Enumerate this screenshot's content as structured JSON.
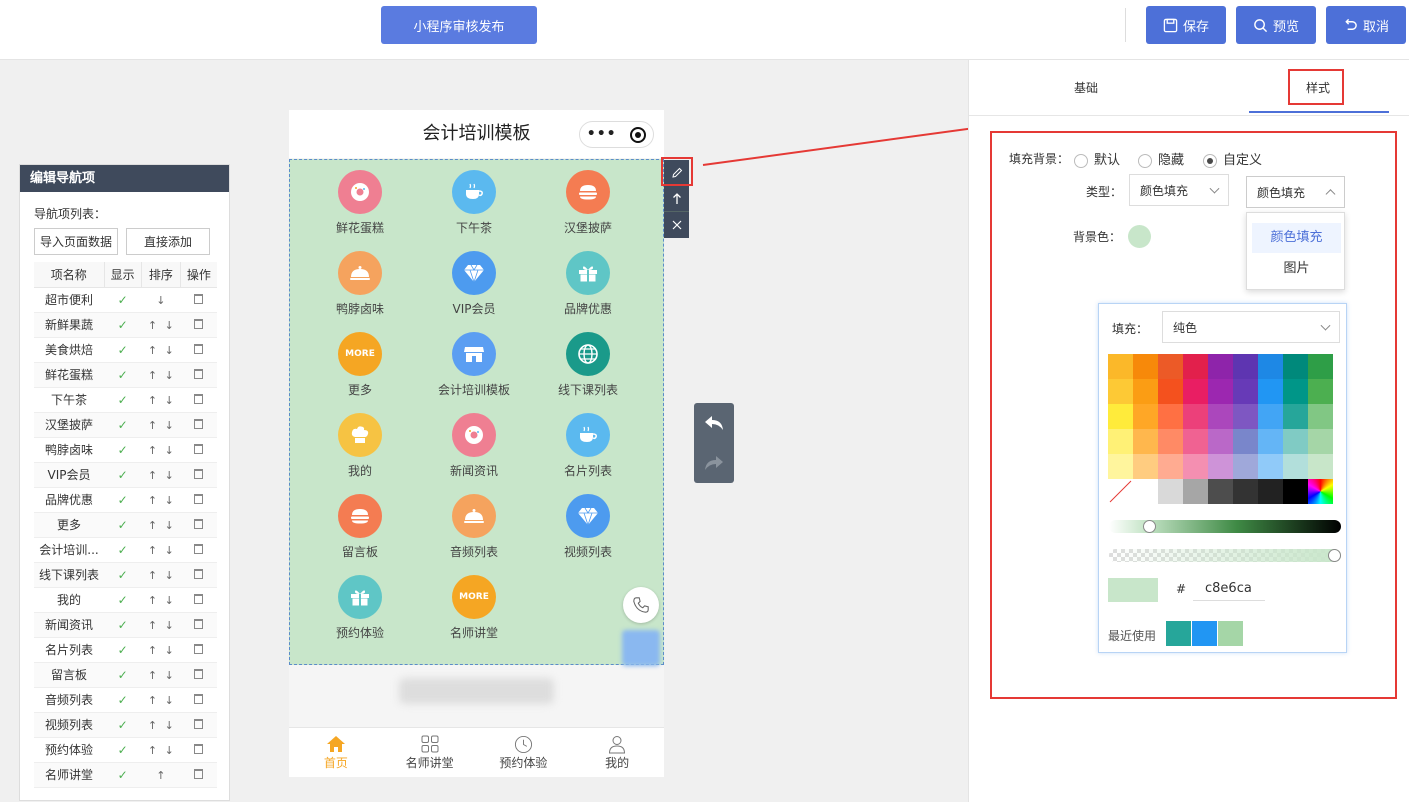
{
  "topbar": {
    "publish": "小程序审核发布",
    "save": "保存",
    "preview": "预览",
    "cancel": "取消"
  },
  "leftpanel": {
    "title": "编辑导航项",
    "list_label": "导航项列表：",
    "import_btn": "导入页面数据",
    "add_btn": "直接添加",
    "headers": [
      "项名称",
      "显示",
      "排序",
      "操作"
    ],
    "rows": [
      "超市便利",
      "新鲜果蔬",
      "美食烘焙",
      "鲜花蛋糕",
      "下午茶",
      "汉堡披萨",
      "鸭脖卤味",
      "VIP会员",
      "品牌优惠",
      "更多",
      "会计培训...",
      "线下课列表",
      "我的",
      "新闻资讯",
      "名片列表",
      "留言板",
      "音频列表",
      "视频列表",
      "预约体验",
      "名师讲堂"
    ],
    "check": "✓"
  },
  "phone": {
    "title": "会计培训模板",
    "items": [
      {
        "label": "鲜花蛋糕",
        "color": "#ef7f92",
        "icon": "donut"
      },
      {
        "label": "下午茶",
        "color": "#5bb9ef",
        "icon": "cup"
      },
      {
        "label": "汉堡披萨",
        "color": "#f47c52",
        "icon": "burger"
      },
      {
        "label": "鸭脖卤味",
        "color": "#f5a35e",
        "icon": "dish"
      },
      {
        "label": "VIP会员",
        "color": "#4d9bef",
        "icon": "diamond"
      },
      {
        "label": "品牌优惠",
        "color": "#5fc6c6",
        "icon": "gift"
      },
      {
        "label": "更多",
        "color": "#f5a623",
        "icon": "MORE"
      },
      {
        "label": "会计培训模板",
        "color": "#5b9ef2",
        "icon": "shop"
      },
      {
        "label": "线下课列表",
        "color": "#1a9a8a",
        "icon": "globe"
      },
      {
        "label": "我的",
        "color": "#f6c343",
        "icon": "chef"
      },
      {
        "label": "新闻资讯",
        "color": "#ef7f92",
        "icon": "donut"
      },
      {
        "label": "名片列表",
        "color": "#5bb9ef",
        "icon": "cup"
      },
      {
        "label": "留言板",
        "color": "#f47c52",
        "icon": "burger"
      },
      {
        "label": "音频列表",
        "color": "#f5a35e",
        "icon": "dish"
      },
      {
        "label": "视频列表",
        "color": "#4d9bef",
        "icon": "diamond"
      },
      {
        "label": "预约体验",
        "color": "#5fc6c6",
        "icon": "gift"
      },
      {
        "label": "名师讲堂",
        "color": "#f5a623",
        "icon": "MORE"
      }
    ],
    "more_text": "MORE",
    "tabs": [
      {
        "label": "首页",
        "icon": "home-icon"
      },
      {
        "label": "名师讲堂",
        "icon": "grid-icon"
      },
      {
        "label": "预约体验",
        "icon": "clock-icon"
      },
      {
        "label": "我的",
        "icon": "user-icon"
      }
    ]
  },
  "rightpanel": {
    "tab_basic": "基础",
    "tab_style": "样式",
    "fill_bg_label": "填充背景：",
    "radio_default": "默认",
    "radio_hide": "隐藏",
    "radio_custom": "自定义",
    "type_label": "类型：",
    "type_value": "颜色填充",
    "dropdown_selected": "颜色填充",
    "dropdown_options": [
      "颜色填充",
      "图片"
    ],
    "bg_color_label": "背景色：",
    "bg_color": "#c8e6ca",
    "picker": {
      "fill_label": "填充：",
      "fill_value": "纯色",
      "hash": "#",
      "hex": "c8e6ca",
      "recent_label": "最近使用",
      "recent_colors": [
        "#26a69a",
        "#2196f3",
        "#a5d6a7"
      ],
      "palette": [
        [
          "#fbb829",
          "#f7890a",
          "#ec5a27",
          "#e2204c",
          "#8e24aa",
          "#5e35b1",
          "#1e88e5",
          "#00897b",
          "#2e9e47"
        ],
        [
          "#fdc935",
          "#fb9d14",
          "#f4511e",
          "#e91e63",
          "#9c27b0",
          "#673ab7",
          "#2196f3",
          "#009688",
          "#4caf50"
        ],
        [
          "#ffeb3b",
          "#ffa726",
          "#ff7043",
          "#ec407a",
          "#ab47bc",
          "#7e57c2",
          "#42a5f5",
          "#26a69a",
          "#81c784"
        ],
        [
          "#fff176",
          "#ffb74d",
          "#ff8a65",
          "#f06292",
          "#ba68c8",
          "#7986cb",
          "#64b5f6",
          "#80cbc4",
          "#a5d6a7"
        ],
        [
          "#fff59d",
          "#ffcc80",
          "#ffab91",
          "#f48fb1",
          "#ce93d8",
          "#9fa8da",
          "#90caf9",
          "#b2dfdb",
          "#c8e6c9"
        ],
        [
          "none",
          "#ffffff",
          "#d9d9d9",
          "#a6a6a6",
          "#4d4d4d",
          "#333333",
          "#222222",
          "#000000",
          "rainbow"
        ]
      ]
    }
  }
}
